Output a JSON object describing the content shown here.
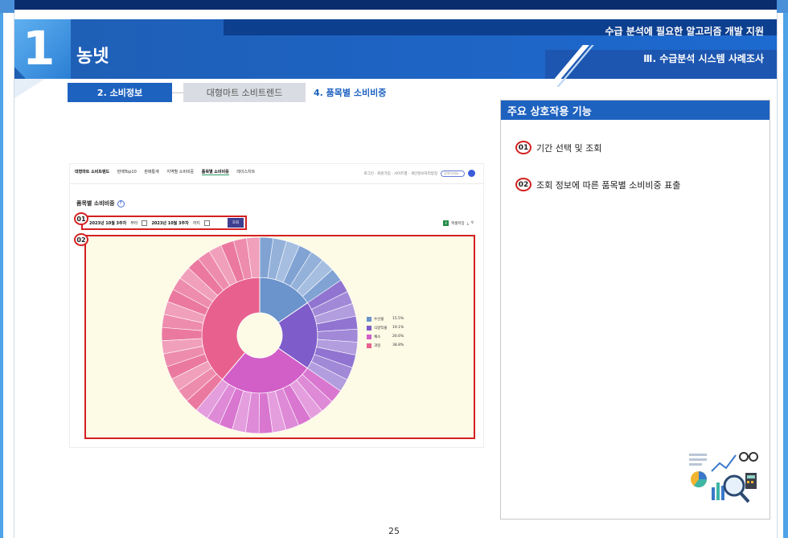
{
  "header": {
    "number": "1",
    "title": "농넷",
    "subtitle_top": "수급 분석에 필요한 알고리즘 개발 지원",
    "subtitle_bottom": "Ⅲ. 수급분석 시스템 사례조사"
  },
  "breadcrumb": {
    "step1": "2. 소비정보",
    "step2": "대형마트 소비트렌드",
    "step3": "4. 품목별 소비비중"
  },
  "app": {
    "nav": {
      "brand": "대형마트 소비트렌드",
      "items": [
        "판매Top10",
        "판매통계",
        "지역별 소비비중",
        "품목별 소비비중",
        "레이스차트"
      ],
      "active_index": 3,
      "right_links": "로그인 · 회원가입 · 사이트맵 · 개인정보처리방침",
      "search_placeholder": "검색하세요"
    },
    "page_title": "품목별 소비비중",
    "filter": {
      "start": "2023년 10월 3주차",
      "start_suffix": "부터",
      "end": "2023년 10월 3주차",
      "end_suffix": "까지",
      "query_button": "조회"
    },
    "excel_label": "엑셀저장",
    "excel_icon": "X"
  },
  "callouts": {
    "c1": "01",
    "c2": "02"
  },
  "chart_data": {
    "type": "pie",
    "subtype": "sunburst",
    "series": [
      {
        "name": "수산물",
        "value": 15.5,
        "color": "#6b93cc"
      },
      {
        "name": "식량작물",
        "value": 19.1,
        "color": "#7e5cc9"
      },
      {
        "name": "채소",
        "value": 26.6,
        "color": "#d25ec8"
      },
      {
        "name": "과일",
        "value": 38.8,
        "color": "#e8618e"
      }
    ],
    "legend_position": "right"
  },
  "panel": {
    "title": "주요 상호작용 기능",
    "features": [
      {
        "num": "01",
        "text": "기간 선택 및 조회"
      },
      {
        "num": "02",
        "text": "조회 정보에 따른 품목별 소비비중 표출"
      }
    ]
  },
  "page_number": "25"
}
